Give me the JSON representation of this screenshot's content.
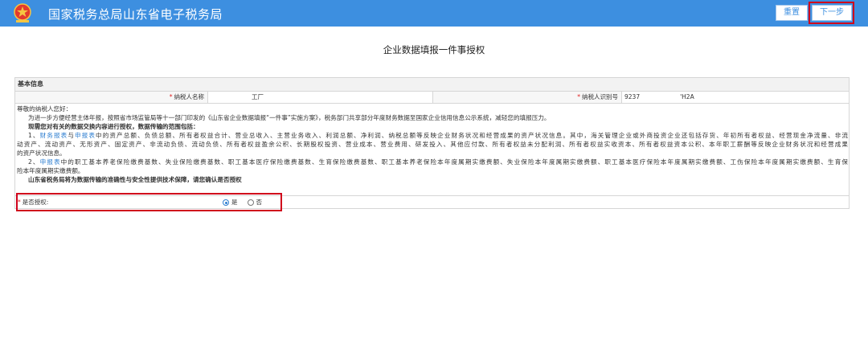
{
  "header": {
    "site_title": "国家税务总局山东省电子税务局",
    "logo_icon": "tax-emblem-icon",
    "reset_label": "重置",
    "next_label": "下一步",
    "bg_color": "#3d8fe0"
  },
  "page_title": "企业数据填报一件事授权",
  "basic_info": {
    "section_title": "基本信息",
    "taxpayer_name_label": "纳税人名称",
    "taxpayer_name_value": "工厂",
    "taxpayer_id_label": "纳税人识别号",
    "taxpayer_id_prefix": "9237",
    "taxpayer_id_suffix": "'H2A"
  },
  "notice": {
    "greeting": "尊敬的纳税人您好：",
    "intro": "为进一步方便经营主体年报，按照省市场监管局等十一部门印发的《山东省企业数据填报“一件事”实施方案》，税务部门共享部分年度财务数据至国家企业信用信息公示系统，减轻您的填报压力。",
    "scope_heading": "现需您对有关的数据交换内容进行授权，数据传输的范围包括：",
    "item1_num": "1、",
    "item1_link1": "财务报表",
    "item1_and": "与",
    "item1_link2": "申报表",
    "item1_line1": "中的资产总额、负债总额、所有者权益合计、营业总收入、主营业务收入、利润总额、净利润、纳税总额等反映企业财务状况和经营成果的资产状况信息。其中，海关管理企业或外商投资企业还包括存货、年初所有者权益、经营现金净流量、非流",
    "item1_line2": "动资产、流动资产、无形资产、固定资产、非流动负债、流动负债、所有者权益盈余公积、长期股权投资、营业成本、营业费用、研发投入、其他应付款、所有者权益未分配利润、所有者权益实收资本、所有者权益资本公积、本年职工薪酬等反映企业财务状况和经营成果",
    "item1_line3": "的资产状况信息。",
    "item2_num": "2、",
    "item2_link": "申报表",
    "item2_line1": "中的职工基本养老保险缴费基数、失业保险缴费基数、职工基本医疗保险缴费基数、生育保险缴费基数、职工基本养老保险本年度属期实缴费额、失业保险本年度属期实缴费额、职工基本医疗保险本年度属期实缴费额、工伤保险本年度属期实缴费额、生育保",
    "item2_line2": "险本年度属期实缴费额。",
    "confirm": "山东省税务局将为数据传输的准确性与安全性提供技术保障，请您确认是否授权"
  },
  "consent": {
    "label": "是否授权:",
    "yes": "是",
    "no": "否",
    "selected": "是"
  }
}
